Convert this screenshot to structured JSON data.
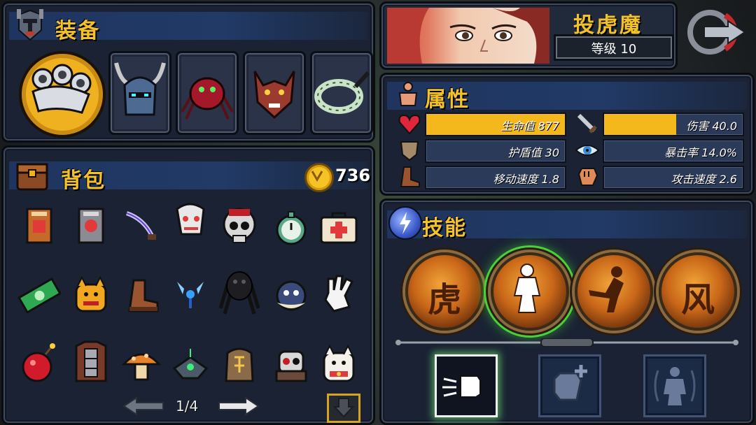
{
  "equipment": {
    "title": "装备",
    "slots": [
      "brass-knuckles-weapon",
      "horned-helmet",
      "spider-pet",
      "wolf-mask",
      "bone-ring"
    ]
  },
  "bag": {
    "title": "背包",
    "coins": "736",
    "page": "1/4",
    "items": [
      [
        "potion-book-red",
        "skull-book",
        "curved-dagger",
        "clown-head",
        "bloody-skull",
        "pocket-watch",
        "first-aid-kit"
      ],
      [
        "cash-bundle",
        "lucky-cat-gold",
        "leather-boot",
        "blue-fairy",
        "shadow-spider",
        "pufferfish",
        "white-glove"
      ],
      [
        "red-bomb",
        "armor-vest",
        "mushroom",
        "robot-drone",
        "rune-stone",
        "skull-robot",
        "fortune-cat"
      ]
    ]
  },
  "character": {
    "name": "投虎魔",
    "level": "等级 10"
  },
  "attributes": {
    "title": "属性",
    "stats": [
      {
        "key": "hp",
        "label": "生命值 877",
        "fill": 1.0,
        "icon": "heart-icon"
      },
      {
        "key": "damage",
        "label": "伤害 40.0",
        "fill": 0.5,
        "icon": "sword-icon"
      },
      {
        "key": "shield",
        "label": "护盾值 30",
        "fill": 0.0,
        "icon": "shield-icon"
      },
      {
        "key": "crit",
        "label": "暴击率 14.0%",
        "fill": 0.0,
        "icon": "eye-icon"
      },
      {
        "key": "move",
        "label": "移动速度 1.8",
        "fill": 0.0,
        "icon": "boot-icon"
      },
      {
        "key": "atkspeed",
        "label": "攻击速度 2.6",
        "fill": 0.0,
        "icon": "fist-icon"
      }
    ]
  },
  "skills": {
    "title": "技能",
    "orbs": [
      "虎",
      "figure",
      "kick",
      "风"
    ],
    "selected_orb": 1
  },
  "colors": {
    "accent": "#f3c22a",
    "bar_fill": "#f5b81c",
    "panel": "#1a2233",
    "selected_glow": "#49d13b"
  }
}
